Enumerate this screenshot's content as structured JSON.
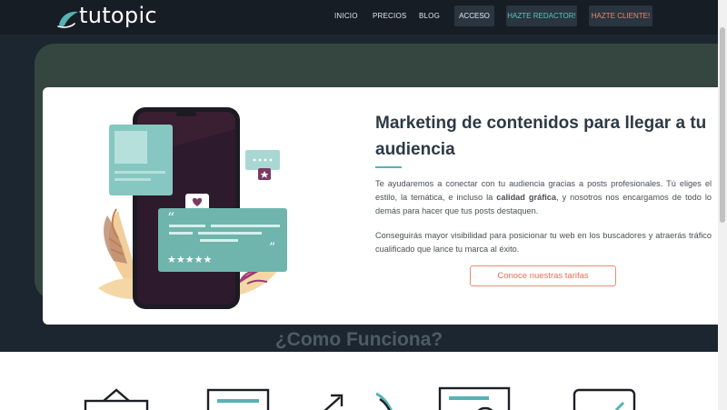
{
  "brand": {
    "name": "tutopic",
    "accent": "#54b3b3",
    "dark_bg": "#1c2630",
    "cta_color": "#e47055"
  },
  "nav": {
    "links": [
      "INICIO",
      "PRECIOS",
      "BLOG"
    ],
    "acceso": "ACCESO",
    "redactor": "HAZTE REDACTOR!",
    "cliente": "HAZTE CLIENTE!"
  },
  "hero": {
    "title": "Marketing de contenidos para llegar a tu audiencia",
    "p1_pre": "Te ayudaremos a conectar con tu audiencia gracias a posts profesionales. Tú eliges el estilo, la temática, e incluso la ",
    "p1_bold": "calidad gráfica",
    "p1_post": ", y nosotros nos encargamos de todo lo demás para hacer que tus posts destaquen.",
    "p2": "Conseguirás mayor visibilidad para posicionar tu web en los buscadores y atraerás tráfico cualificado que lance tu marca al éxito.",
    "cta": "Conoce nuestras tarifas"
  },
  "how": {
    "title": "¿Como Funciona?"
  },
  "icons": {
    "logo": "leaf-icon",
    "illustration": "smartphone-review-illustration",
    "steps": [
      "briefcase-icon",
      "document-icon",
      "arrow-rocket-icon",
      "monitor-icon",
      "checklist-icon"
    ]
  }
}
